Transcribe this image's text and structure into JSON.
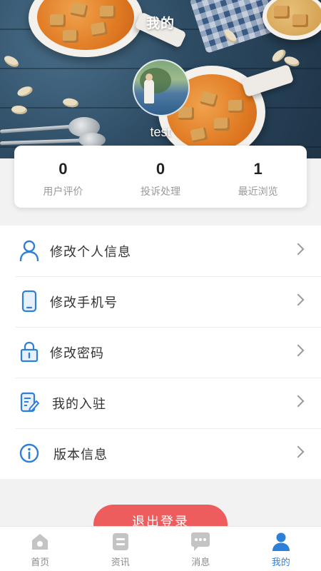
{
  "header": {
    "title": "我的",
    "username": "test"
  },
  "stats": [
    {
      "value": "0",
      "label": "用户评价"
    },
    {
      "value": "0",
      "label": "投诉处理"
    },
    {
      "value": "1",
      "label": "最近浏览"
    }
  ],
  "menu": [
    {
      "label": "修改个人信息",
      "icon": "user-icon"
    },
    {
      "label": "修改手机号",
      "icon": "phone-icon"
    },
    {
      "label": "修改密码",
      "icon": "lock-icon"
    },
    {
      "label": "我的入驻",
      "icon": "edit-document-icon"
    },
    {
      "label": "版本信息",
      "icon": "info-icon"
    }
  ],
  "logout_label": "退出登录",
  "tabbar": [
    {
      "label": "首页",
      "icon": "home-icon",
      "active": false
    },
    {
      "label": "资讯",
      "icon": "news-icon",
      "active": false
    },
    {
      "label": "消息",
      "icon": "message-icon",
      "active": false
    },
    {
      "label": "我的",
      "icon": "profile-icon",
      "active": true
    }
  ],
  "colors": {
    "accent": "#2e7fd8",
    "logout": "#ee5d5d",
    "inactive": "#c4c4c4"
  }
}
